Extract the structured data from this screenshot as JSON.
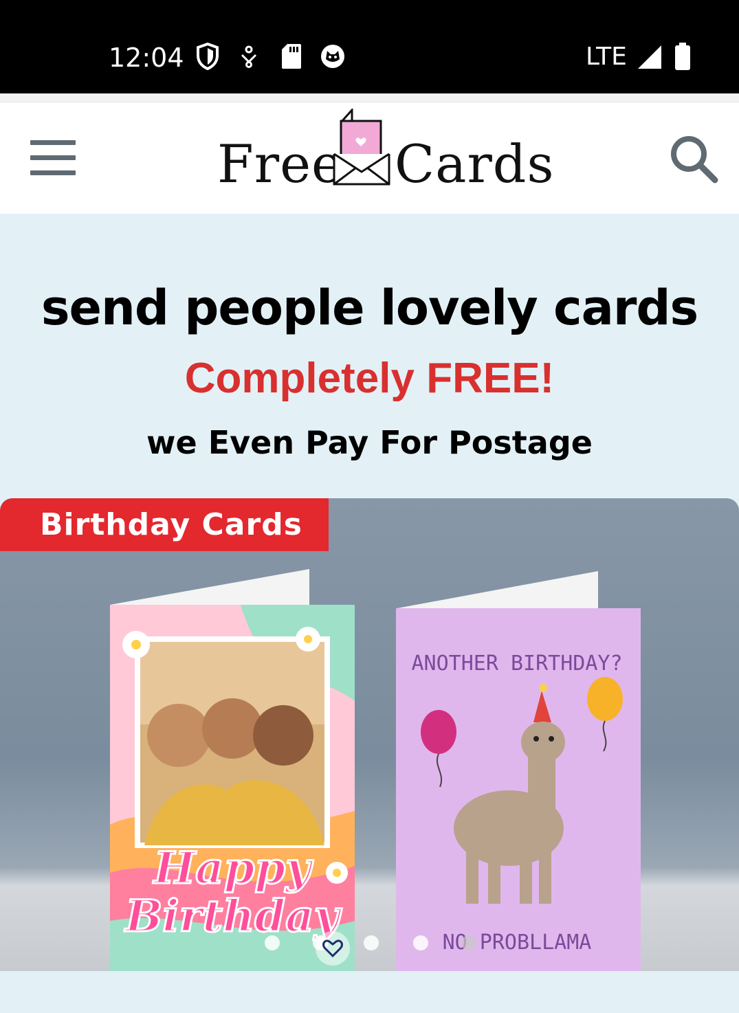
{
  "status_bar": {
    "time": "12:04",
    "network": "LTE",
    "icons": [
      "shield-icon",
      "download-icon",
      "sd-card-icon",
      "cat-face-icon",
      "signal-icon",
      "battery-icon"
    ]
  },
  "header": {
    "logo_left": "Free",
    "logo_right": "Cards",
    "icons": [
      "menu-icon",
      "card-envelope-logo-icon",
      "search-icon"
    ]
  },
  "hero": {
    "title": "send people lovely cards",
    "highlight": "Completely FREE!",
    "subtitle": "we Even Pay For Postage"
  },
  "carousel": {
    "category_label": "Birthday Cards",
    "cards": [
      {
        "name": "happy-birthday-photo-card",
        "text_top": "",
        "text_main": "Happy Birthday"
      },
      {
        "name": "llama-birthday-card",
        "text_top": "ANOTHER BIRTHDAY?",
        "text_main": "NO PROBLLAMA"
      }
    ],
    "dot_count": 5,
    "active_dot": 4
  },
  "colors": {
    "hero_bg": "#e3f1f6",
    "accent_red": "#d8302f",
    "tag_red": "#e3282e",
    "logo_pink": "#f2a9d6"
  }
}
